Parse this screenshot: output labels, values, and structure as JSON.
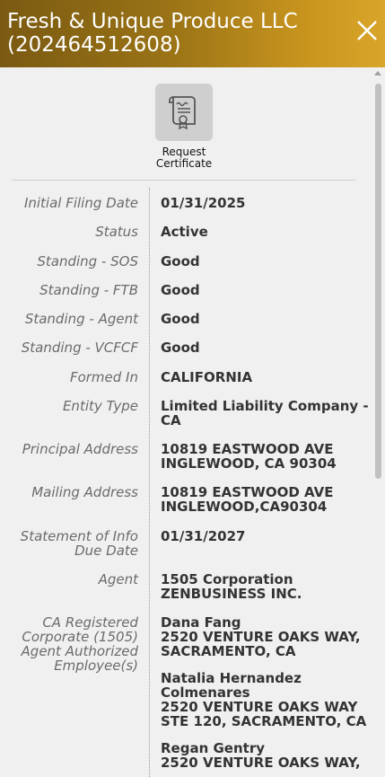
{
  "header": {
    "title_line1": "Fresh & Unique Produce LLC",
    "title_line2": "(202464512608)"
  },
  "certificate": {
    "label_line1": "Request",
    "label_line2": "Certificate"
  },
  "details": {
    "initial_filing_date": {
      "label": "Initial Filing Date",
      "value": "01/31/2025"
    },
    "status": {
      "label": "Status",
      "value": "Active"
    },
    "standing_sos": {
      "label": "Standing - SOS",
      "value": "Good"
    },
    "standing_ftb": {
      "label": "Standing - FTB",
      "value": "Good"
    },
    "standing_agent": {
      "label": "Standing - Agent",
      "value": "Good"
    },
    "standing_vcfcf": {
      "label": "Standing - VCFCF",
      "value": "Good"
    },
    "formed_in": {
      "label": "Formed In",
      "value": "CALIFORNIA"
    },
    "entity_type": {
      "label": "Entity Type",
      "value_line1": "Limited Liability Company -",
      "value_line2": "CA"
    },
    "principal_address": {
      "label": "Principal Address",
      "value_line1": "10819 EASTWOOD AVE",
      "value_line2": "INGLEWOOD, CA 90304"
    },
    "mailing_address": {
      "label": "Mailing Address",
      "value_line1": "10819 EASTWOOD AVE",
      "value_line2": "INGLEWOOD,CA90304"
    },
    "statement_due": {
      "label_line1": "Statement of Info",
      "label_line2": "Due Date",
      "value": "01/31/2027"
    },
    "agent": {
      "label": "Agent",
      "value_line1": "1505 Corporation",
      "value_line2": "ZENBUSINESS INC."
    },
    "ca_registered": {
      "label_line1": "CA Registered",
      "label_line2": "Corporate (1505)",
      "label_line3": "Agent Authorized",
      "label_line4": "Employee(s)",
      "employees": [
        {
          "name": "Dana Fang",
          "addr1": "2520 VENTURE OAKS WAY,",
          "addr2": "SACRAMENTO, CA"
        },
        {
          "name_line1": "Natalia Hernandez",
          "name_line2": "Colmenares",
          "addr1": "2520 VENTURE OAKS WAY",
          "addr2": "STE 120, SACRAMENTO, CA"
        },
        {
          "name": "Regan Gentry",
          "addr1": "2520 VENTURE OAKS WAY,"
        }
      ]
    }
  }
}
